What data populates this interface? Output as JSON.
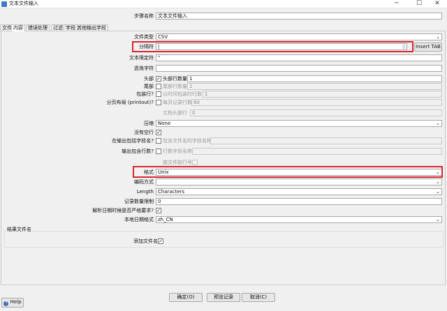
{
  "window": {
    "title": "文本文件输入",
    "minimize": "─",
    "maximize": "☐",
    "close": "✕"
  },
  "step_name": {
    "label": "步骤名称",
    "value": "文本文件输入"
  },
  "tabs": [
    "文件",
    "内容",
    "错误处理",
    "过滤",
    "字段",
    "其他输出字段"
  ],
  "form": {
    "file_type": {
      "label": "文件类型",
      "value": "CSV"
    },
    "separator": {
      "label": "分隔符",
      "value": "|",
      "button": "Insert TAB"
    },
    "enclosure": {
      "label": "文本限定符",
      "value": "\""
    },
    "escape": {
      "label": "逃逸字符",
      "value": ""
    },
    "header": {
      "label": "头部",
      "checked": true,
      "sublabel": "头部行数量",
      "value": "1"
    },
    "footer": {
      "label": "尾部",
      "checked": false,
      "sublabel": "尾部行数量",
      "value": "1"
    },
    "wrap": {
      "label": "包装行?",
      "checked": false,
      "sublabel": "以时间包装的行数",
      "value": "1"
    },
    "paged": {
      "label": "分页布局 (printout)?",
      "checked": false,
      "sublabel": "每页记录行数",
      "value": "80"
    },
    "doc_header": {
      "sublabel": "文档头部行",
      "value": "0"
    },
    "compression": {
      "label": "压缩",
      "value": "None"
    },
    "no_empty": {
      "label": "没有空行",
      "checked": true
    },
    "include_filename": {
      "label": "在输出包括字段名?",
      "checked": false,
      "sublabel": "包含文件名的字段名称",
      "value": ""
    },
    "include_rownum": {
      "label": "输出包含行数?",
      "checked": false,
      "sublabel": "行数字段名称",
      "value": ""
    },
    "rownum_by_file": {
      "sublabel": "按文件取行号",
      "checked": false
    },
    "format": {
      "label": "格式",
      "value": "Unix"
    },
    "encoding": {
      "label": "编码方式",
      "value": ""
    },
    "length": {
      "label": "Length",
      "value": "Characters"
    },
    "limit": {
      "label": "记录数量限制",
      "value": "0"
    },
    "lenient_date": {
      "label": "解析日期时候是否严格要求?",
      "checked": true
    },
    "locale": {
      "label": "本地日期格式",
      "value": "zh_CN"
    }
  },
  "result_group": {
    "title": "结果文件名",
    "add_filename": {
      "label": "添加文件名",
      "checked": true
    }
  },
  "buttons": {
    "ok": "确定(O)",
    "preview": "预览记录",
    "cancel": "取消(C)",
    "help": "Help"
  },
  "icons": [
    "app-icon",
    "help-icon",
    "variable-icon",
    "chevron-down-icon"
  ],
  "colors": {
    "highlight": "#d9262c",
    "field_bg": "#ffffff"
  }
}
